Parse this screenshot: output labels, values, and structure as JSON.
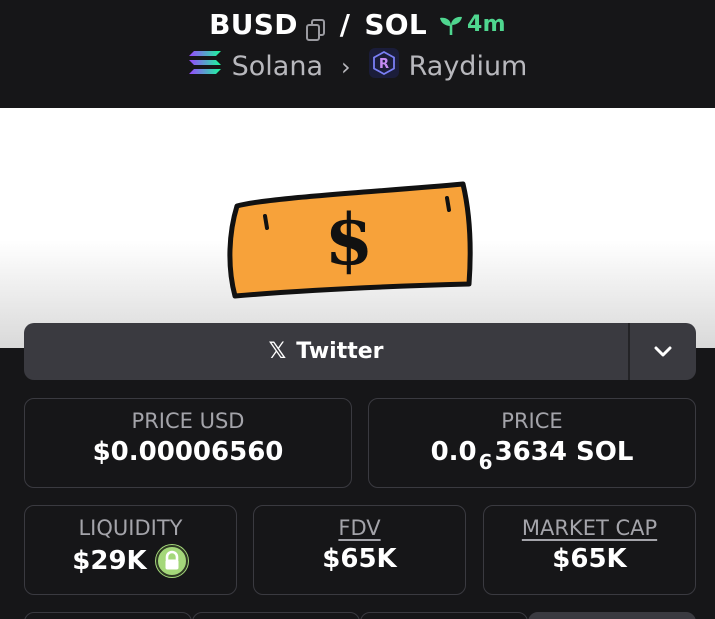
{
  "header": {
    "base_token": "BUSD",
    "separator": "/",
    "quote_token": "SOL",
    "age": "4m",
    "chain": "Solana",
    "dex": "Raydium"
  },
  "links": {
    "twitter_label": "Twitter"
  },
  "stats": {
    "price_usd_label": "PRICE USD",
    "price_usd_value": "$0.00006560",
    "price_label": "PRICE",
    "price_prefix": "0.0",
    "price_zeros": "6",
    "price_digits": "3634 SOL",
    "liquidity_label": "LIQUIDITY",
    "liquidity_value": "$29K",
    "fdv_label": "FDV",
    "fdv_value": "$65K",
    "mcap_label": "MARKET CAP",
    "mcap_value": "$65K"
  },
  "colors": {
    "background": "#161618",
    "card_border": "#3a3a40",
    "button_bg": "#3a3a40",
    "age_green": "#4fd68f",
    "lock_green": "#a4d87a",
    "bill_orange": "#f7a23a"
  }
}
